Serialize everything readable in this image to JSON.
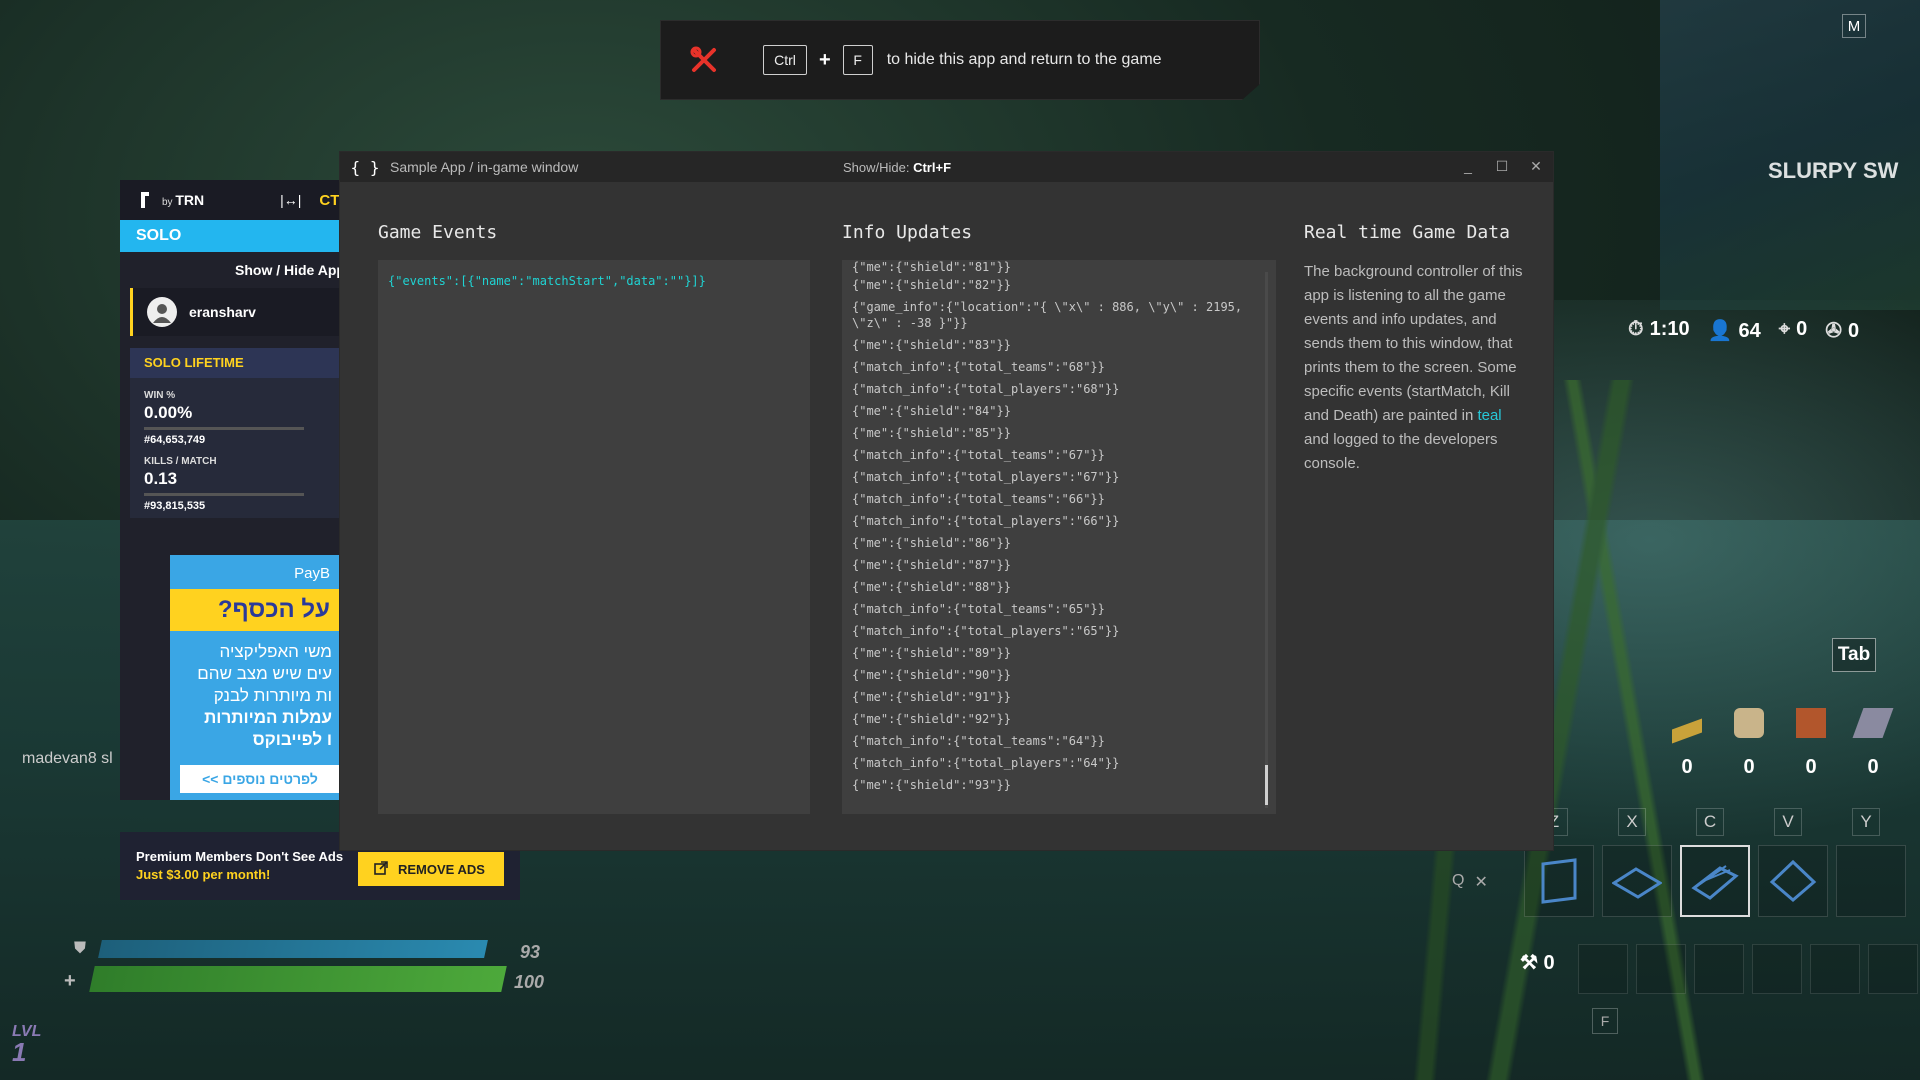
{
  "banner": {
    "key1": "Ctrl",
    "plus": "+",
    "key2": "F",
    "text": "to hide this app and return to the game"
  },
  "trn": {
    "by": "by",
    "brand": "TRN",
    "ct": "CT",
    "mode": "SOLO",
    "show_hide": "Show / Hide App",
    "username": "eransharv",
    "lifetime_title": "SOLO LIFETIME",
    "stats": [
      {
        "label": "WIN %",
        "value": "0.00%",
        "rank": "#64,653,749"
      },
      {
        "label": "KILLS / MATCH",
        "value": "0.13",
        "rank": "#93,815,535"
      }
    ]
  },
  "ad": {
    "brand": "PayB",
    "headline": "על הכסף?",
    "lines": [
      "משי האפליקציה",
      "עים שיש מצב שהם",
      "ות מיותרות לבנק",
      "עמלות המיותרות",
      "ו לפייבוקס"
    ],
    "button": "לפרטים נוספים >>"
  },
  "premium": {
    "line1": "Premium Members Don't See Ads",
    "line2": "Just $3.00 per month!",
    "button": "REMOVE ADS"
  },
  "app": {
    "logo": "{ }",
    "title": "Sample App / in-game window",
    "hint_prefix": "Show/Hide: ",
    "hint_keys": "Ctrl+F",
    "controls": {
      "minimize": "_",
      "maximize": "☐",
      "close": "✕"
    }
  },
  "game_events": {
    "title": "Game Events",
    "lines": [
      "{\"events\":[{\"name\":\"matchStart\",\"data\":\"\"}]}"
    ]
  },
  "info_updates": {
    "title": "Info Updates",
    "lines": [
      "{\"me\":{\"shield\":\"81\"}}",
      "{\"me\":{\"shield\":\"82\"}}",
      "{\"game_info\":{\"location\":\"{ \\\"x\\\" : 886, \\\"y\\\" : 2195, \\\"z\\\" : -38 }\"}}",
      "{\"me\":{\"shield\":\"83\"}}",
      "{\"match_info\":{\"total_teams\":\"68\"}}",
      "{\"match_info\":{\"total_players\":\"68\"}}",
      "{\"me\":{\"shield\":\"84\"}}",
      "{\"me\":{\"shield\":\"85\"}}",
      "{\"match_info\":{\"total_teams\":\"67\"}}",
      "{\"match_info\":{\"total_players\":\"67\"}}",
      "{\"match_info\":{\"total_teams\":\"66\"}}",
      "{\"match_info\":{\"total_players\":\"66\"}}",
      "{\"me\":{\"shield\":\"86\"}}",
      "{\"me\":{\"shield\":\"87\"}}",
      "{\"me\":{\"shield\":\"88\"}}",
      "{\"match_info\":{\"total_teams\":\"65\"}}",
      "{\"match_info\":{\"total_players\":\"65\"}}",
      "{\"me\":{\"shield\":\"89\"}}",
      "{\"me\":{\"shield\":\"90\"}}",
      "{\"me\":{\"shield\":\"91\"}}",
      "{\"me\":{\"shield\":\"92\"}}",
      "{\"match_info\":{\"total_teams\":\"64\"}}",
      "{\"match_info\":{\"total_players\":\"64\"}}",
      "{\"me\":{\"shield\":\"93\"}}"
    ]
  },
  "realtime": {
    "title": "Real time Game Data",
    "text_before": "The background controller of this app is listening to all the game events and info updates, and sends them to this window, that prints them to the screen. Some specific events (startMatch, Kill and Death) are painted in ",
    "teal_word": "teal",
    "text_after": " and logged to the developers console."
  },
  "hud": {
    "map_key": "M",
    "location": "SLURPY SW",
    "time": "1:10",
    "players": "64",
    "kills": "0",
    "assists": "0",
    "tab": "Tab",
    "materials": [
      "0",
      "0",
      "0",
      "0"
    ],
    "build_keys": [
      "Z",
      "X",
      "C",
      "V",
      "Y"
    ],
    "q_key": "Q",
    "ammo": "0",
    "f_key": "F",
    "player_name": "madevan8 sl",
    "shield": "93",
    "health": "100",
    "level_label": "LVL",
    "level": "1"
  },
  "colors": {
    "teal": "#1fd3d3",
    "accent_yellow": "#ffd21f",
    "trn_blue": "#23b6ef",
    "tools_red": "#e8332a"
  }
}
